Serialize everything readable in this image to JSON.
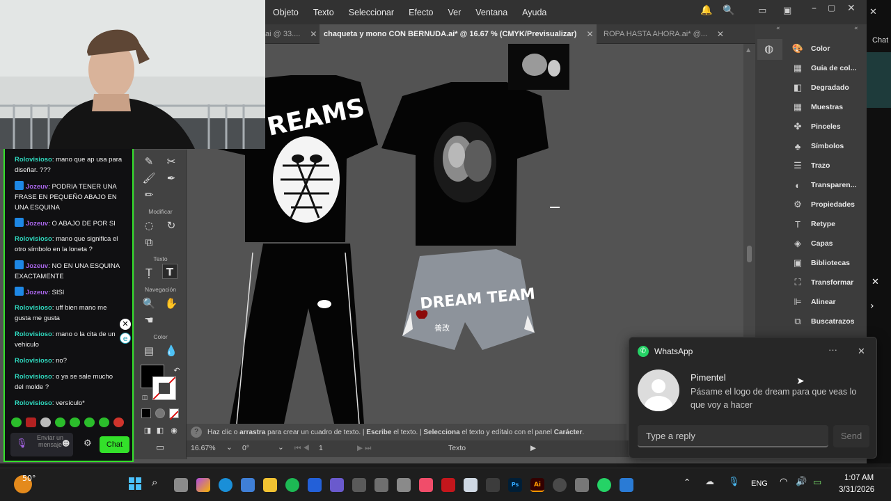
{
  "menubar": [
    "Objeto",
    "Texto",
    "Seleccionar",
    "Efecto",
    "Ver",
    "Ventana",
    "Ayuda"
  ],
  "tabs": [
    {
      "label": "ai @ 33...."
    },
    {
      "label": "chaqueta y mono CON BERNUDA.ai* @ 16.67 % (CMYK/Previsualizar)"
    },
    {
      "label": "ROPA HASTA AHORA.ai* @..."
    }
  ],
  "toolbar_sections": {
    "modify": "Modificar",
    "text": "Texto",
    "navigation": "Navegación",
    "color": "Color"
  },
  "panels": [
    "Color",
    "Guía de col...",
    "Degradado",
    "Muestras",
    "Pinceles",
    "Símbolos",
    "Trazo",
    "Transparen...",
    "Propiedades",
    "Retype",
    "Capas",
    "Bibliotecas",
    "Transformar",
    "Alinear",
    "Buscatrazos"
  ],
  "artwork": {
    "tee_text": "REAMS",
    "shorts_text": "DREAM TEAM",
    "shorts_kanji": "善改"
  },
  "hint": {
    "a1": "Haz clic o ",
    "b1": "arrastra",
    "a2": " para crear un cuadro de texto.  |  ",
    "b2": "Escribe",
    "a3": " el texto.  |  ",
    "b3": "Selecciona",
    "a4": " el texto y edítalo con el panel ",
    "b4": "Carácter",
    "a5": "."
  },
  "status": {
    "zoom": "16.67%",
    "rotation": "0°",
    "artboard": "1",
    "tool": "Texto"
  },
  "chat": {
    "messages": [
      {
        "user": "Rolovisioso",
        "text": "mano que ap usa para diseñar. ???",
        "style": "a"
      },
      {
        "user": "Jozeuv",
        "text": "PODRIA TENER UNA FRASE EN PEQUEÑO ABAJO EN UNA ESQUINA",
        "style": "b"
      },
      {
        "user": "Jozeuv",
        "text": "O ABAJO DE POR SI",
        "style": "b"
      },
      {
        "user": "Rolovisioso",
        "text": "mano que significa el otro símbolo en la loneta ?",
        "style": "a"
      },
      {
        "user": "Jozeuv",
        "text": "NO EN UNA ESQUINA EXACTAMENTE",
        "style": "b"
      },
      {
        "user": "Jozeuv",
        "text": "SISI",
        "style": "b"
      },
      {
        "user": "Rolovisioso",
        "text": "uff bien mano me gusta me gusta",
        "style": "a"
      },
      {
        "user": "Rolovisioso",
        "text": "mano o la cita de un vehiculo",
        "style": "a"
      },
      {
        "user": "Rolovisioso",
        "text": "no?",
        "style": "a"
      },
      {
        "user": "Rolovisioso",
        "text": "o ya se sale mucho del molde ?",
        "style": "a"
      },
      {
        "user": "Rolovisioso",
        "text": "versículo*",
        "style": "a"
      }
    ],
    "input_placeholder": "Enviar un mensaje",
    "send_label": "Chat",
    "side_label": "Chat"
  },
  "whatsapp": {
    "app": "WhatsApp",
    "sender": "Pimentel",
    "message": "Pásame el logo de dream para que veas lo que voy a hacer",
    "reply_placeholder": "Type a reply",
    "send_label": "Send"
  },
  "taskbar": {
    "weather_temp": "50°",
    "language": "ENG",
    "time": "1:07 AM",
    "date": "3/31/2026"
  },
  "colors": {
    "chat_border": "#33e02a",
    "accent": "#1e88e5",
    "whatsapp_green": "#25d366"
  }
}
